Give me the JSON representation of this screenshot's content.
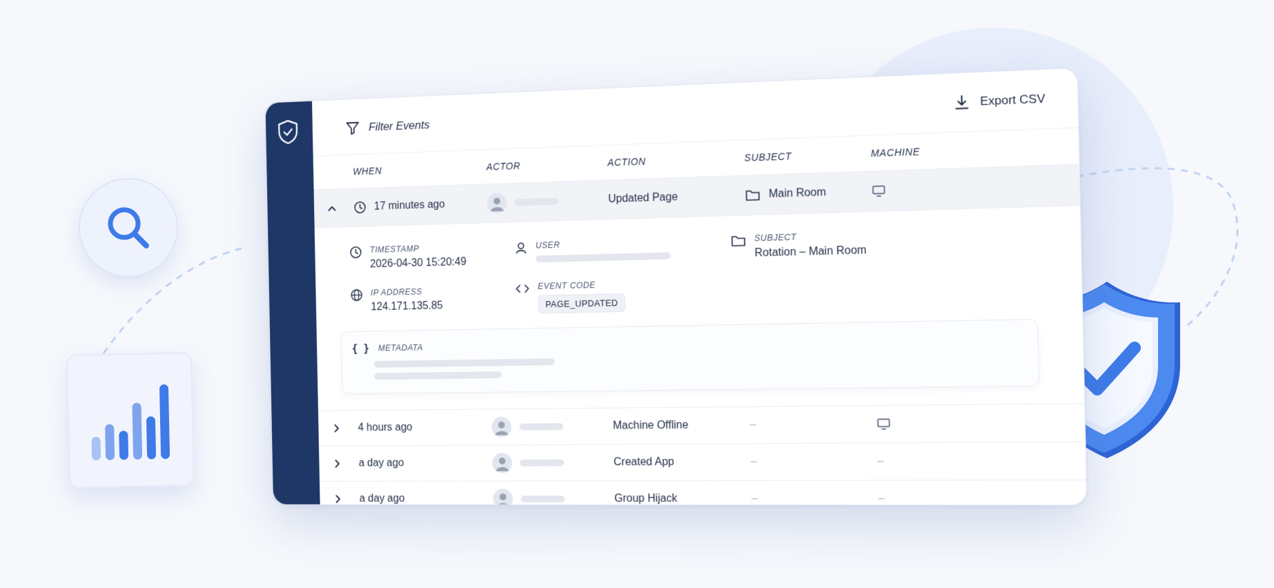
{
  "colors": {
    "sidebar": "#1e3766",
    "accent": "#3e7be8",
    "accent_light": "#a9c2f4",
    "skeleton": "#e3e6ec"
  },
  "toolbar": {
    "filter_label": "Filter Events",
    "filter_icon": "filter-icon",
    "export_label": "Export CSV",
    "export_icon": "download-icon"
  },
  "table": {
    "columns": [
      "WHEN",
      "ACTOR",
      "ACTION",
      "SUBJECT",
      "MACHINE"
    ],
    "expanded_row": {
      "when": "17 minutes ago",
      "action": "Updated Page",
      "subject": "Main Room",
      "machine_icon": "monitor-icon"
    },
    "detail": {
      "timestamp_label": "TIMESTAMP",
      "timestamp_value": "2026-04-30 15:20:49",
      "user_label": "USER",
      "subject_label": "SUBJECT",
      "subject_value": "Rotation – Main Room",
      "ip_label": "IP ADDRESS",
      "ip_value": "124.171.135.85",
      "event_code_label": "EVENT CODE",
      "event_code_value": "PAGE_UPDATED",
      "metadata_label": "METADATA",
      "metadata_icon": "{ }"
    },
    "rows": [
      {
        "when": "4 hours ago",
        "action": "Machine Offline",
        "subject": "–",
        "machine": "monitor-icon"
      },
      {
        "when": "a day ago",
        "action": "Created App",
        "subject": "–",
        "machine": "–"
      },
      {
        "when": "a day ago",
        "action": "Group Hijack",
        "subject": "–",
        "machine": "–"
      }
    ]
  },
  "decor": {
    "search_icon": "search-icon",
    "chart_icon": "bar-chart-icon",
    "shield_icon": "shield-check-icon"
  }
}
